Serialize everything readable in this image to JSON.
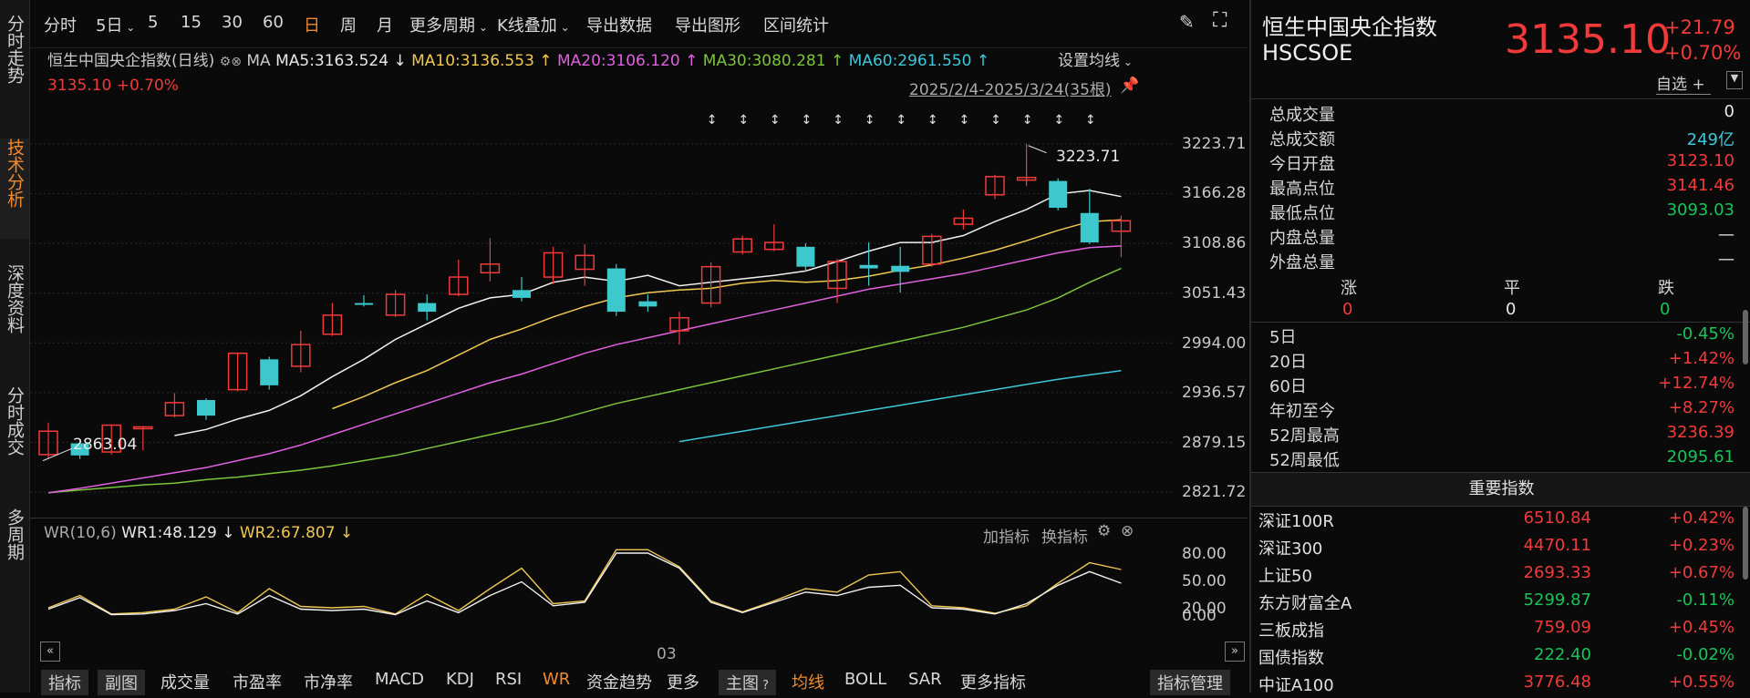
{
  "leftnav": [
    "分时走势",
    "技术分析",
    "深度资料",
    "分时成交",
    "多周期"
  ],
  "toolbar": {
    "items": [
      "分时",
      "5日",
      "5",
      "15",
      "30",
      "60",
      "日",
      "周",
      "月",
      "更多周期",
      "K线叠加",
      "导出数据",
      "导出图形",
      "区间统计"
    ],
    "active": "日"
  },
  "chart_header": {
    "name": "恒生中国央企指数(日线)",
    "ma_label": "MA",
    "ma5": "MA5:3163.524",
    "ma10": "MA10:3136.553",
    "ma20": "MA20:3106.120",
    "ma30": "MA30:3080.281",
    "ma60": "MA60:2961.550",
    "set_ma": "设置均线",
    "price_line": "3135.10 +0.70%",
    "range": "2025/2/4-2025/3/24(35根)",
    "high_note": "3223.71",
    "low_note": "2863.04"
  },
  "chart_data": {
    "type": "candlestick",
    "y_ticks": [
      "3223.71",
      "3166.28",
      "3108.86",
      "3051.43",
      "2994.00",
      "2936.57",
      "2879.15",
      "2821.72"
    ],
    "ylim": [
      2821.72,
      3223.71
    ],
    "candles": [
      {
        "o": 2865,
        "c": 2892,
        "h": 2902,
        "l": 2860,
        "up": true
      },
      {
        "o": 2878,
        "c": 2864,
        "h": 2880,
        "l": 2860,
        "up": false
      },
      {
        "o": 2868,
        "c": 2899,
        "h": 2900,
        "l": 2865,
        "up": true
      },
      {
        "o": 2896,
        "c": 2897,
        "h": 2898,
        "l": 2870,
        "up": true
      },
      {
        "o": 2910,
        "c": 2925,
        "h": 2936,
        "l": 2908,
        "up": true
      },
      {
        "o": 2928,
        "c": 2910,
        "h": 2930,
        "l": 2905,
        "up": false
      },
      {
        "o": 2940,
        "c": 2982,
        "h": 2983,
        "l": 2938,
        "up": true
      },
      {
        "o": 2975,
        "c": 2945,
        "h": 2978,
        "l": 2940,
        "up": false
      },
      {
        "o": 2967,
        "c": 2992,
        "h": 3008,
        "l": 2960,
        "up": true
      },
      {
        "o": 3004,
        "c": 3026,
        "h": 3040,
        "l": 3002,
        "up": true
      },
      {
        "o": 3040,
        "c": 3039,
        "h": 3049,
        "l": 3036,
        "up": false
      },
      {
        "o": 3026,
        "c": 3050,
        "h": 3055,
        "l": 3024,
        "up": true
      },
      {
        "o": 3040,
        "c": 3030,
        "h": 3050,
        "l": 3020,
        "up": false
      },
      {
        "o": 3050,
        "c": 3070,
        "h": 3090,
        "l": 3048,
        "up": true
      },
      {
        "o": 3075,
        "c": 3085,
        "h": 3115,
        "l": 3065,
        "up": true
      },
      {
        "o": 3055,
        "c": 3046,
        "h": 3070,
        "l": 3042,
        "up": false
      },
      {
        "o": 3070,
        "c": 3098,
        "h": 3105,
        "l": 3062,
        "up": true
      },
      {
        "o": 3079,
        "c": 3095,
        "h": 3108,
        "l": 3060,
        "up": true
      },
      {
        "o": 3080,
        "c": 3030,
        "h": 3085,
        "l": 3025,
        "up": false
      },
      {
        "o": 3042,
        "c": 3036,
        "h": 3050,
        "l": 3030,
        "up": false
      },
      {
        "o": 3008,
        "c": 3023,
        "h": 3030,
        "l": 2992,
        "up": true
      },
      {
        "o": 3040,
        "c": 3082,
        "h": 3087,
        "l": 3035,
        "up": true
      },
      {
        "o": 3099,
        "c": 3114,
        "h": 3118,
        "l": 3096,
        "up": true
      },
      {
        "o": 3102,
        "c": 3110,
        "h": 3131,
        "l": 3100,
        "up": true
      },
      {
        "o": 3105,
        "c": 3082,
        "h": 3109,
        "l": 3076,
        "up": false
      },
      {
        "o": 3057,
        "c": 3088,
        "h": 3091,
        "l": 3040,
        "up": true
      },
      {
        "o": 3084,
        "c": 3080,
        "h": 3110,
        "l": 3060,
        "up": false
      },
      {
        "o": 3083,
        "c": 3076,
        "h": 3105,
        "l": 3052,
        "up": false
      },
      {
        "o": 3085,
        "c": 3117,
        "h": 3120,
        "l": 3082,
        "up": true
      },
      {
        "o": 3131,
        "c": 3138,
        "h": 3148,
        "l": 3125,
        "up": true
      },
      {
        "o": 3165,
        "c": 3186,
        "h": 3188,
        "l": 3160,
        "up": true
      },
      {
        "o": 3182,
        "c": 3185,
        "h": 3224,
        "l": 3175,
        "up": true
      },
      {
        "o": 3181,
        "c": 3150,
        "h": 3184,
        "l": 3147,
        "up": false
      },
      {
        "o": 3144,
        "c": 3110,
        "h": 3172,
        "l": 3108,
        "up": false
      },
      {
        "o": 3123,
        "c": 3135,
        "h": 3141,
        "l": 3093,
        "up": true
      }
    ],
    "ma5": [
      null,
      null,
      null,
      null,
      2887,
      2894,
      2906,
      2916,
      2933,
      2955,
      2975,
      2998,
      3016,
      3034,
      3046,
      3050,
      3064,
      3070,
      3065,
      3072,
      3060,
      3064,
      3068,
      3072,
      3077,
      3088,
      3100,
      3110,
      3110,
      3118,
      3134,
      3148,
      3166,
      3170,
      3163
    ],
    "ma10": [
      null,
      null,
      null,
      null,
      null,
      null,
      null,
      null,
      null,
      2918,
      2932,
      2948,
      2962,
      2980,
      2998,
      3010,
      3024,
      3036,
      3046,
      3052,
      3055,
      3057,
      3063,
      3066,
      3064,
      3066,
      3071,
      3078,
      3084,
      3092,
      3101,
      3112,
      3124,
      3134,
      3136
    ],
    "ma20": [
      2821,
      2826,
      2832,
      2838,
      2844,
      2850,
      2858,
      2866,
      2876,
      2888,
      2900,
      2912,
      2924,
      2936,
      2948,
      2958,
      2970,
      2982,
      2992,
      3000,
      3008,
      3016,
      3024,
      3032,
      3040,
      3048,
      3056,
      3062,
      3068,
      3074,
      3082,
      3090,
      3098,
      3104,
      3106
    ],
    "ma30": [
      2821,
      2824,
      2827,
      2830,
      2832,
      2836,
      2839,
      2843,
      2847,
      2852,
      2858,
      2864,
      2872,
      2880,
      2888,
      2896,
      2904,
      2914,
      2924,
      2932,
      2940,
      2948,
      2956,
      2964,
      2972,
      2980,
      2988,
      2996,
      3004,
      3012,
      3022,
      3032,
      3046,
      3064,
      3080
    ],
    "ma60": [
      null,
      null,
      null,
      null,
      null,
      null,
      null,
      null,
      null,
      null,
      null,
      null,
      null,
      null,
      null,
      null,
      null,
      null,
      null,
      null,
      2880,
      2886,
      2892,
      2898,
      2904,
      2910,
      2916,
      2922,
      2928,
      2934,
      2940,
      2946,
      2952,
      2957,
      2962
    ],
    "wr": {
      "label": "WR(10,6)",
      "wr1": "WR1:48.129",
      "wr2": "WR2:67.807",
      "ticks": [
        "80.00",
        "50.00",
        "20.00",
        "0.00"
      ],
      "add": "加指标",
      "swap": "换指标",
      "wr1_values": [
        10,
        27,
        2,
        3,
        8,
        18,
        3,
        30,
        10,
        8,
        10,
        2,
        22,
        5,
        30,
        50,
        15,
        20,
        92,
        92,
        70,
        20,
        5,
        20,
        35,
        30,
        42,
        45,
        12,
        10,
        3,
        18,
        45,
        65,
        48
      ],
      "wr2_values": [
        12,
        30,
        3,
        5,
        10,
        28,
        5,
        40,
        14,
        12,
        14,
        3,
        32,
        8,
        40,
        70,
        18,
        22,
        97,
        97,
        72,
        22,
        6,
        22,
        40,
        35,
        60,
        65,
        15,
        12,
        4,
        15,
        48,
        78,
        68
      ]
    },
    "x_label": "03"
  },
  "bottom": {
    "left": [
      "指标",
      "副图",
      "成交量",
      "市盈率",
      "市净率",
      "MACD",
      "KDJ",
      "RSI",
      "WR",
      "资金趋势",
      "更多"
    ],
    "right": [
      "主图",
      "均线",
      "BOLL",
      "SAR",
      "更多指标"
    ],
    "manage": "指标管理"
  },
  "quote": {
    "name": "恒生中国央企指数",
    "code": "HSCSOE",
    "price": "3135.10",
    "change": "+21.79",
    "pct": "+0.70%",
    "fav": "自选 +",
    "stats": [
      {
        "label": "总成交量",
        "value": "0",
        "color": "#e8e8e8"
      },
      {
        "label": "总成交额",
        "value": "249亿",
        "color": "#3cc8dc"
      },
      {
        "label": "今日开盘",
        "value": "3123.10",
        "color": "#f23a3a"
      },
      {
        "label": "最高点位",
        "value": "3141.46",
        "color": "#f23a3a"
      },
      {
        "label": "最低点位",
        "value": "3093.03",
        "color": "#18c45a"
      },
      {
        "label": "内盘总量",
        "value": "—",
        "color": "#e8e8e8"
      },
      {
        "label": "外盘总量",
        "value": "—",
        "color": "#e8e8e8"
      }
    ],
    "breadth": {
      "up_label": "涨",
      "flat_label": "平",
      "down_label": "跌",
      "up": "0",
      "flat": "0",
      "down": "0"
    },
    "perf": [
      {
        "label": "5日",
        "value": "-0.45%",
        "color": "#18c45a"
      },
      {
        "label": "20日",
        "value": "+1.42%",
        "color": "#f23a3a"
      },
      {
        "label": "60日",
        "value": "+12.74%",
        "color": "#f23a3a"
      },
      {
        "label": "年初至今",
        "value": "+8.27%",
        "color": "#f23a3a"
      },
      {
        "label": "52周最高",
        "value": "3236.39",
        "color": "#f23a3a"
      },
      {
        "label": "52周最低",
        "value": "2095.61",
        "color": "#18c45a"
      }
    ],
    "index_title": "重要指数",
    "indices": [
      {
        "name": "深证100R",
        "price": "6510.84",
        "chg": "+0.42%",
        "color": "#f23a3a"
      },
      {
        "name": "深证300",
        "price": "4470.11",
        "chg": "+0.23%",
        "color": "#f23a3a"
      },
      {
        "name": "上证50",
        "price": "2693.33",
        "chg": "+0.67%",
        "color": "#f23a3a"
      },
      {
        "name": "东方财富全A",
        "price": "5299.87",
        "chg": "-0.11%",
        "color": "#18c45a"
      },
      {
        "name": "三板成指",
        "price": "759.09",
        "chg": "+0.45%",
        "color": "#f23a3a"
      },
      {
        "name": "国债指数",
        "price": "222.40",
        "chg": "-0.02%",
        "color": "#18c45a"
      },
      {
        "name": "中证A100",
        "price": "3776.48",
        "chg": "+0.55%",
        "color": "#f23a3a"
      }
    ]
  }
}
